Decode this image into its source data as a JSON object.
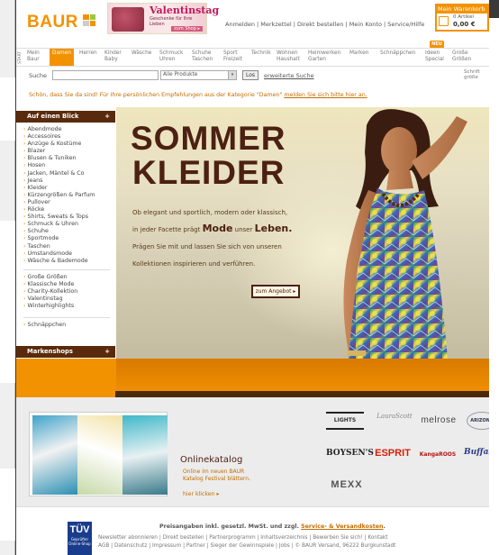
{
  "header": {
    "logo": "BAUR",
    "promo": {
      "title": "Valentinstag",
      "subtitle": "Geschenke für Ihre Lieben",
      "button": "zum Shop ▸"
    },
    "links": "Anmelden | Merkzettel | Direkt bestellen | Mein Konto | Service/Hilfe",
    "cart": {
      "title": "Mein Warenkorb",
      "items": "0 Artikel",
      "total": "0,00 €"
    }
  },
  "nav": {
    "items": [
      {
        "label": "Mein\nBaur"
      },
      {
        "label": "Damen"
      },
      {
        "label": "Herren"
      },
      {
        "label": "Kinder\nBaby"
      },
      {
        "label": "Wäsche"
      },
      {
        "label": "Schmuck\nUhren"
      },
      {
        "label": "Schuhe\nTaschen"
      },
      {
        "label": "Sport\nFreizeit"
      },
      {
        "label": "Technik"
      },
      {
        "label": "Wohnen\nHaushalt"
      },
      {
        "label": "Heimwerken\nGarten"
      },
      {
        "label": "Marken"
      },
      {
        "label": "Schnäppchen"
      },
      {
        "label": "Ideen\nSpecial"
      },
      {
        "label": "Große\nGrößen"
      }
    ],
    "badge_new": "NEU",
    "side_tab": "START"
  },
  "search": {
    "label": "Suche",
    "select": "Alle Produkte",
    "button": "Los",
    "advanced": "erweiterte Suche",
    "size_label": "Schrift\ngröße"
  },
  "greeting": {
    "text": "Schön, dass Sie da sind! Für Ihre persönlichen Empfehlungen aus der Kategorie \"Damen\" ",
    "link": "melden Sie sich bitte hier an."
  },
  "sidebar": {
    "heading": "Auf einen Blick",
    "items": [
      "Abendmode",
      "Accessoires",
      "Anzüge & Kostüme",
      "Blazer",
      "Blusen & Tuniken",
      "Hosen",
      "Jacken, Mäntel & Co",
      "Jeans",
      "Kleider",
      "Kürzengrößen & Parfum",
      "Pullover",
      "Röcke",
      "Shirts, Sweats & Tops",
      "Schmuck & Uhren",
      "Schuhe",
      "Sportmode",
      "Taschen",
      "Umstandsmode",
      "Wäsche & Bademode"
    ],
    "items2": [
      "Große Größen",
      "Klassische Mode",
      "Charity-Kollektion",
      "Valentinstag",
      "Winterhighlights"
    ],
    "items3": [
      "Schnäppchen"
    ],
    "shops": "Markenshops"
  },
  "hero": {
    "title1": "SOMMER",
    "title2": "KLEIDER",
    "line1": "Ob elegant und sportlich, modern oder klassisch,",
    "line2a": "in jeder Facette prägt ",
    "line2b": "Mode",
    "line2c": " unser ",
    "line2d": "Leben.",
    "line3": "Prägen Sie mit und lassen Sie sich von unseren",
    "line4": "Kollektionen inspirieren und verführen.",
    "button": "zum Angebot ▸"
  },
  "catalog": {
    "title": "Onlinekatalog",
    "desc": "Online im neuen BAUR\nKatalog Festival blättern.",
    "link": "hier klicken ▸"
  },
  "brands": [
    "LIGHTS",
    "LauraScott",
    "melrose",
    "ARIZONA",
    "BOYSEN'S",
    "ESPRIT",
    "KangaROOS",
    "Buffalo",
    "MEXX"
  ],
  "footer": {
    "tuv": "TÜV",
    "tuv_sub": "Geprüfter Online-Shop",
    "prices": "Preisangaben inkl. gesetzl. MwSt. und zzgl. ",
    "prices_link": "Service- & Versandkosten",
    "links1": "Newsletter abonnieren | Direkt bestellen | Partnerprogramm | Inhaltsverzeichnis | Bewerben Sie sich! | Kontakt",
    "links2": "AGB | Datenschutz | Impressum | Partner | Sieger der Gewinnspiele | Jobs | © BAUR Versand, 96222 Burgkunstadt"
  },
  "colors": {
    "brand_orange": "#f39200",
    "brown": "#5a2a0c",
    "text_orange": "#c36d00"
  }
}
